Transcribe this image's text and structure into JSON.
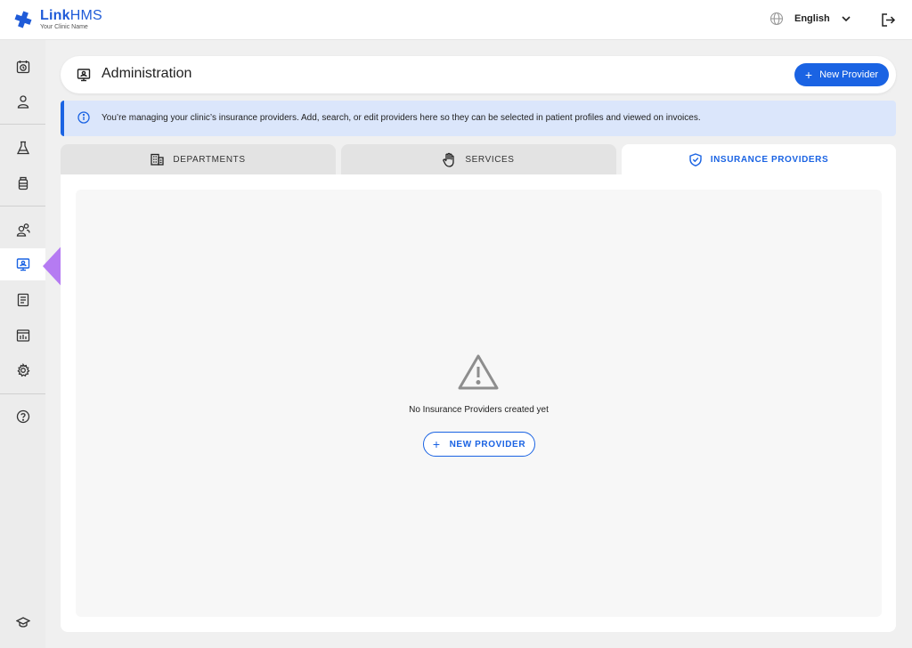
{
  "app": {
    "name_bold": "Link",
    "name_light": "HMS",
    "clinic_name": "Your Clinic Name"
  },
  "topbar": {
    "language": "English",
    "icons": [
      "globe-icon",
      "chevron-down-icon",
      "logout-icon"
    ]
  },
  "sidebar": {
    "items": [
      {
        "icon": "appointments-clock-icon",
        "active": false
      },
      {
        "icon": "patient-person-icon",
        "active": false
      },
      {
        "icon": "lab-flask-icon",
        "active": false
      },
      {
        "icon": "pharmacy-bottle-icon",
        "active": false
      },
      {
        "icon": "staff-users-icon",
        "active": false
      },
      {
        "icon": "administration-monitor-icon",
        "active": true
      },
      {
        "icon": "billing-document-icon",
        "active": false
      },
      {
        "icon": "reports-chart-icon",
        "active": false
      },
      {
        "icon": "settings-gear-icon",
        "active": false
      },
      {
        "icon": "help-question-icon",
        "active": false
      },
      {
        "icon": "education-cap-icon",
        "active": false
      }
    ]
  },
  "header": {
    "title": "Administration",
    "new_button_label": "New Provider"
  },
  "banner": {
    "text": "You’re managing your clinic’s insurance providers. Add, search, or edit providers here so they can be selected in patient profiles and viewed on invoices."
  },
  "tabs": [
    {
      "label": "DEPARTMENTS",
      "icon": "building-icon",
      "active": false
    },
    {
      "label": "SERVICES",
      "icon": "hand-icon",
      "active": false
    },
    {
      "label": "INSURANCE PROVIDERS",
      "icon": "shield-check-icon",
      "active": true
    }
  ],
  "empty_state": {
    "message": "No Insurance Providers created yet",
    "button_label": "NEW PROVIDER",
    "icon": "warning-triangle-icon"
  },
  "colors": {
    "accent": "#1a63e3",
    "banner_bg": "#dbe6fb",
    "arrow": "#b57bf2",
    "sidebar_bg": "#ececec"
  }
}
